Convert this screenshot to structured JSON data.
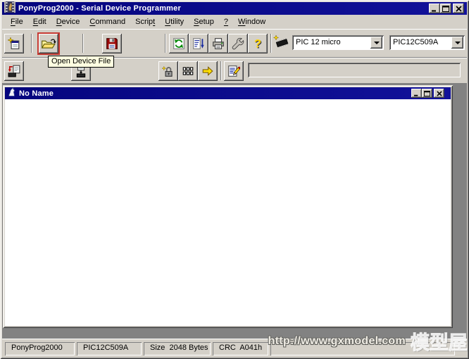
{
  "window": {
    "title": "PonyProg2000 - Serial Device Programmer"
  },
  "menu": {
    "items": [
      {
        "pre": "",
        "key": "F",
        "post": "ile"
      },
      {
        "pre": "",
        "key": "E",
        "post": "dit"
      },
      {
        "pre": "",
        "key": "D",
        "post": "evice"
      },
      {
        "pre": "",
        "key": "C",
        "post": "ommand"
      },
      {
        "pre": "Scrip",
        "key": "t",
        "post": ""
      },
      {
        "pre": "",
        "key": "U",
        "post": "tility"
      },
      {
        "pre": "",
        "key": "S",
        "post": "etup"
      },
      {
        "pre": "",
        "key": "?",
        "post": ""
      },
      {
        "pre": "",
        "key": "W",
        "post": "indow"
      }
    ]
  },
  "toolbar": {
    "tooltip": "Open Device File",
    "family_combo": {
      "value": "PIC 12 micro"
    },
    "device_combo": {
      "value": "PIC12C509A"
    }
  },
  "child_window": {
    "title": "No Name"
  },
  "status_bar": {
    "app": "PonyProg2000",
    "device": "PIC12C509A",
    "size": "Size  2048 Bytes",
    "crc": "CRC  A041h"
  },
  "watermark": {
    "url": "http://www.gxmodel.com",
    "brand": "模型屋"
  },
  "colors": {
    "titlebar-dark": "#05057e",
    "titlebar-light": "#12129a",
    "face": "#d4d0c8",
    "mdi": "#828282",
    "tooltip-bg": "#ffffe1",
    "highlight-red": "#c53a32"
  }
}
